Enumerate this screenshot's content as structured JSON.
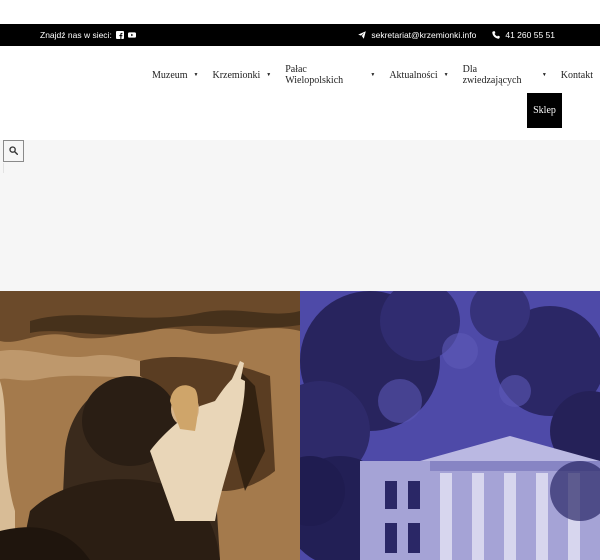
{
  "topbar": {
    "social_label": "Znajdź nas w sieci:",
    "email": "sekretariat@krzemionki.info",
    "phone": "41 260 55 51"
  },
  "icons": {
    "facebook": "facebook-icon",
    "youtube": "youtube-icon",
    "email": "paper-plane-icon",
    "phone": "phone-icon",
    "search": "search-icon"
  },
  "nav": {
    "items": [
      {
        "label": "Muzeum",
        "has_dropdown": true
      },
      {
        "label": "Krzemionki",
        "has_dropdown": true
      },
      {
        "label": "Pałac Wielopolskich",
        "has_dropdown": true
      },
      {
        "label": "Aktualności",
        "has_dropdown": true
      },
      {
        "label": "Dla zwiedzających",
        "has_dropdown": true
      },
      {
        "label": "Kontakt",
        "has_dropdown": false
      }
    ],
    "caret": "▼",
    "shop_label": "Sklep"
  },
  "colors": {
    "topbar_bg": "#000000",
    "gray_band": "#f6f6f6",
    "panel_left_tint": "#a47a4c",
    "panel_right_tint": "#4e4aa8"
  }
}
